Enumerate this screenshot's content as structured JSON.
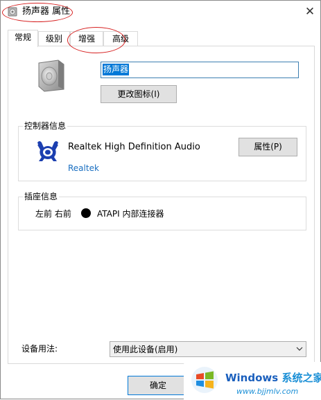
{
  "window": {
    "title": "扬声器 属性",
    "close_glyph": "✕"
  },
  "tabs": [
    {
      "label": "常规",
      "active": true
    },
    {
      "label": "级别",
      "active": false
    },
    {
      "label": "增强",
      "active": false
    },
    {
      "label": "高级",
      "active": false
    }
  ],
  "general": {
    "device_icon": "speaker-icon",
    "device_name": "扬声器",
    "change_icon_button": "更改图标(I)"
  },
  "controller": {
    "group_label": "控制器信息",
    "icon": "realtek-crab-icon",
    "name": "Realtek High Definition Audio",
    "vendor": "Realtek",
    "properties_button": "属性(P)"
  },
  "jack": {
    "group_label": "插座信息",
    "position": "左前 右前",
    "color": "#000000",
    "connector": "ATAPI 内部连接器"
  },
  "usage": {
    "label": "设备用法:",
    "selected": "使用此设备(启用)"
  },
  "footer": {
    "ok_button": "确定"
  },
  "watermark": {
    "brand": "Windows",
    "brand_sub": "系统之家",
    "url": "www.bjjmlv.com"
  },
  "colors": {
    "annotation_circle": "#d61f1f",
    "selection_highlight": "#0078d7",
    "link": "#1a6fc1"
  }
}
